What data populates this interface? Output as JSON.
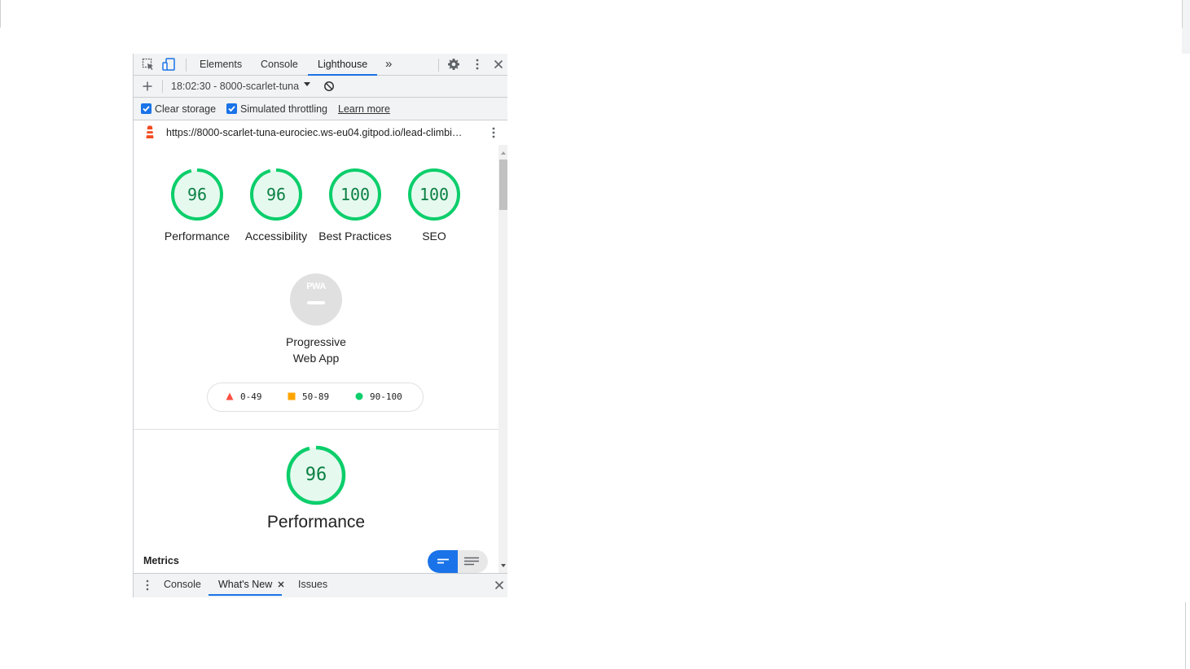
{
  "devtools": {
    "tabs": [
      {
        "label": "Elements"
      },
      {
        "label": "Console"
      },
      {
        "label": "Lighthouse",
        "active": true
      }
    ],
    "more_tabs_glyph": "»",
    "report_selector": "18:02:30 - 8000-scarlet-tuna",
    "options": {
      "clear_storage": {
        "label": "Clear storage",
        "checked": true
      },
      "simulated_throttling": {
        "label": "Simulated throttling",
        "checked": true
      },
      "learn_more": "Learn more"
    },
    "url": "https://8000-scarlet-tuna-eurociec.ws-eu04.gitpod.io/lead-climbi…"
  },
  "report": {
    "scores": [
      {
        "value": "96",
        "label": "Performance",
        "fraction": 0.96
      },
      {
        "value": "96",
        "label": "Accessibility",
        "fraction": 0.96
      },
      {
        "value": "100",
        "label": "Best Practices",
        "fraction": 1.0
      },
      {
        "value": "100",
        "label": "SEO",
        "fraction": 1.0
      }
    ],
    "pwa": {
      "badge": "PWA",
      "label": "Progressive Web App"
    },
    "legend": [
      {
        "range": "0-49",
        "color": "#ff4e42",
        "shape": "triangle"
      },
      {
        "range": "50-89",
        "color": "#ffa400",
        "shape": "square"
      },
      {
        "range": "90-100",
        "color": "#0cce6b",
        "shape": "circle"
      }
    ],
    "performance": {
      "value": "96",
      "title": "Performance",
      "fraction": 0.96
    },
    "metrics_heading": "Metrics"
  },
  "drawer": {
    "tabs": [
      {
        "label": "Console"
      },
      {
        "label": "What's New",
        "active": true,
        "closable": true
      },
      {
        "label": "Issues"
      }
    ]
  },
  "colors": {
    "pass": "#0cce6b",
    "pass_text": "#0b8043",
    "accent": "#1a73e8",
    "pwa_grey": "#e0e0e0"
  }
}
